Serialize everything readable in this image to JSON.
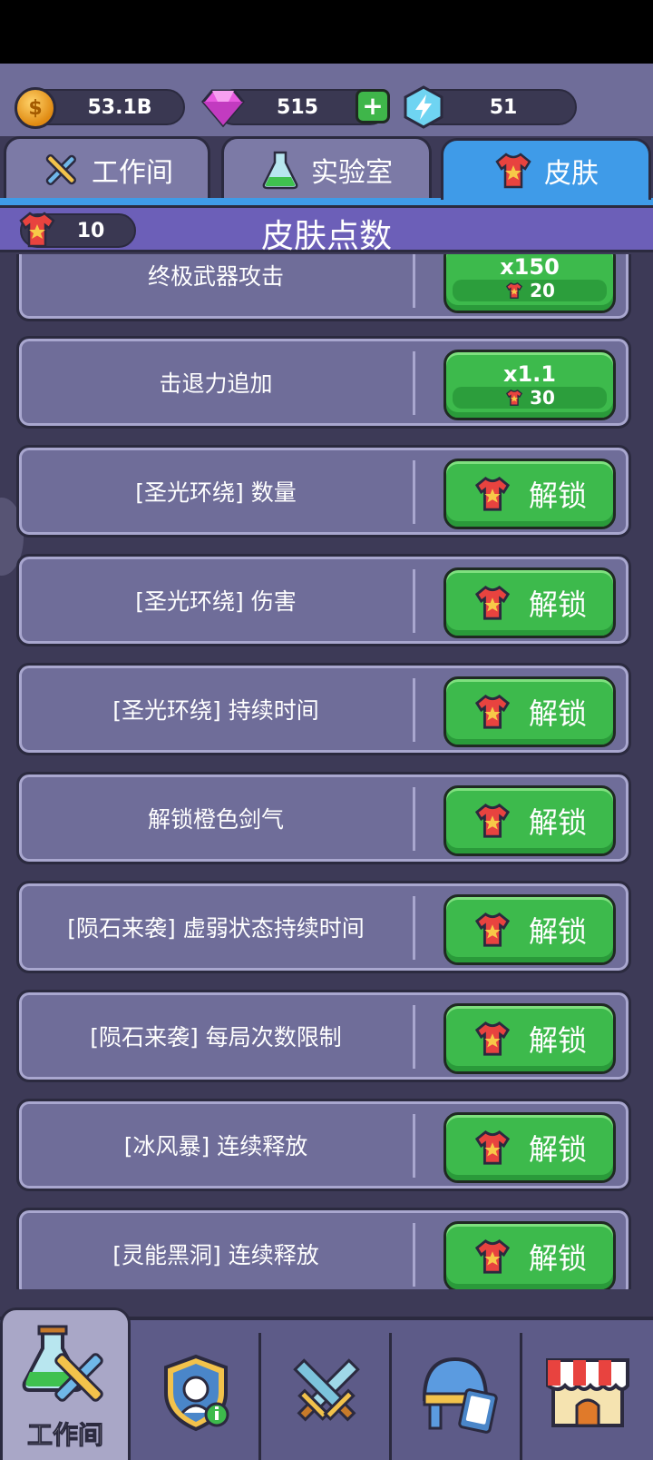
{
  "currencies": {
    "coin_value": "53.1B",
    "gem_value": "515",
    "energy_value": "51",
    "coin_symbol": "$",
    "plus_label": "+"
  },
  "tabs": [
    {
      "label": "工作间",
      "icon": "tools-icon"
    },
    {
      "label": "实验室",
      "icon": "flask-icon"
    },
    {
      "label": "皮肤",
      "icon": "shirt-icon",
      "active": true
    }
  ],
  "header": {
    "title": "皮肤点数",
    "skin_points": "10"
  },
  "rows": [
    {
      "label": "终极武器攻击",
      "button": {
        "type": "upgrade",
        "multiplier": "x150",
        "cost": "20"
      }
    },
    {
      "label": "击退力追加",
      "button": {
        "type": "upgrade",
        "multiplier": "x1.1",
        "cost": "30"
      }
    },
    {
      "label": "[圣光环绕] 数量",
      "button": {
        "type": "unlock",
        "text": "解锁"
      }
    },
    {
      "label": "[圣光环绕] 伤害",
      "button": {
        "type": "unlock",
        "text": "解锁"
      }
    },
    {
      "label": "[圣光环绕] 持续时间",
      "button": {
        "type": "unlock",
        "text": "解锁"
      }
    },
    {
      "label": "解锁橙色剑气",
      "button": {
        "type": "unlock",
        "text": "解锁"
      }
    },
    {
      "label": "[陨石来袭] 虚弱状态持续时间",
      "button": {
        "type": "unlock",
        "text": "解锁"
      }
    },
    {
      "label": "[陨石来袭] 每局次数限制",
      "button": {
        "type": "unlock",
        "text": "解锁"
      }
    },
    {
      "label": "[冰风暴] 连续释放",
      "button": {
        "type": "unlock",
        "text": "解锁"
      }
    },
    {
      "label": "[灵能黑洞] 连续释放",
      "button": {
        "type": "unlock",
        "text": "解锁"
      }
    }
  ],
  "bottom_nav": [
    {
      "label": "工作间",
      "icon": "workshop-icon",
      "active": true
    },
    {
      "label": "",
      "icon": "hero-shield-icon"
    },
    {
      "label": "",
      "icon": "crossed-swords-icon"
    },
    {
      "label": "",
      "icon": "helmet-cards-icon"
    },
    {
      "label": "",
      "icon": "shop-icon"
    }
  ],
  "colors": {
    "accent_blue": "#3f9be8",
    "button_green": "#3dba4c",
    "panel_purple": "#6f6d99",
    "header_purple": "#6c5fb8"
  }
}
